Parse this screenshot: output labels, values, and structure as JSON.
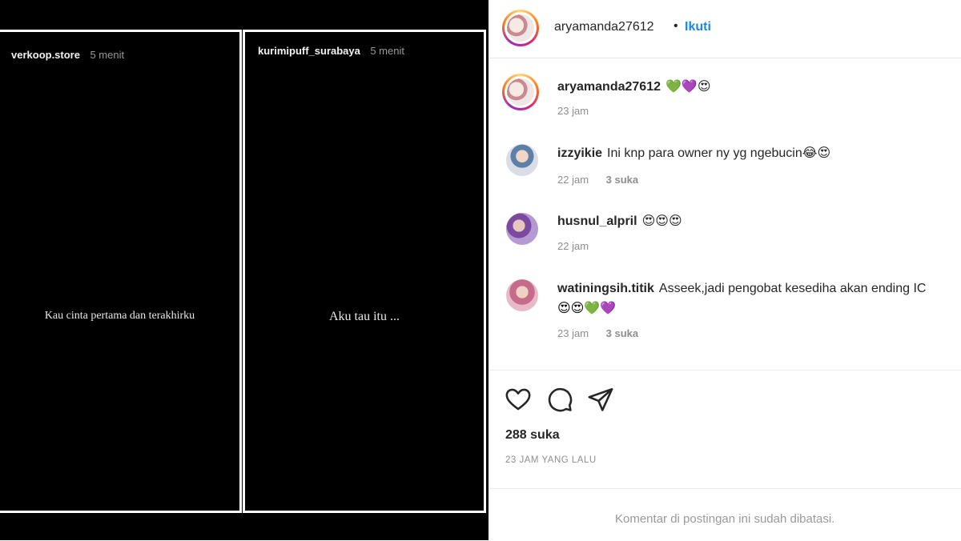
{
  "stories": [
    {
      "username": "verkoop.store",
      "time": "5 menit",
      "text": "Kau cinta pertama dan terakhirku"
    },
    {
      "username": "kurimipuff_surabaya",
      "time": "5 menit",
      "text": "Aku tau itu ..."
    }
  ],
  "post": {
    "header": {
      "username": "aryamanda27612",
      "dot": "•",
      "follow_label": "Ikuti"
    },
    "comments": [
      {
        "username": "aryamanda27612",
        "text": "💚💜😍",
        "time": "23 jam",
        "likes": ""
      },
      {
        "username": "izzyikie",
        "text": "Ini knp para owner ny yg ngebucin😂😍",
        "time": "22 jam",
        "likes": "3 suka"
      },
      {
        "username": "husnul_alpril",
        "text": "😍😍😍",
        "time": "22 jam",
        "likes": ""
      },
      {
        "username": "watiningsih.titik",
        "text": "Asseek,jadi pengobat kesediha akan ending IC",
        "text_line2": "😍😍💚💜",
        "time": "23 jam",
        "likes": "3 suka"
      }
    ],
    "actions": {
      "like_icon": "heart-icon",
      "comment_icon": "comment-icon",
      "share_icon": "share-icon"
    },
    "likes_count": "288 suka",
    "timestamp": "23 JAM YANG LALU",
    "limited_comments_notice": "Komentar di postingan ini sudah dibatasi.",
    "colors": {
      "follow": "#1e88e5",
      "muted": "#8e8e8e",
      "text": "#262626"
    }
  }
}
